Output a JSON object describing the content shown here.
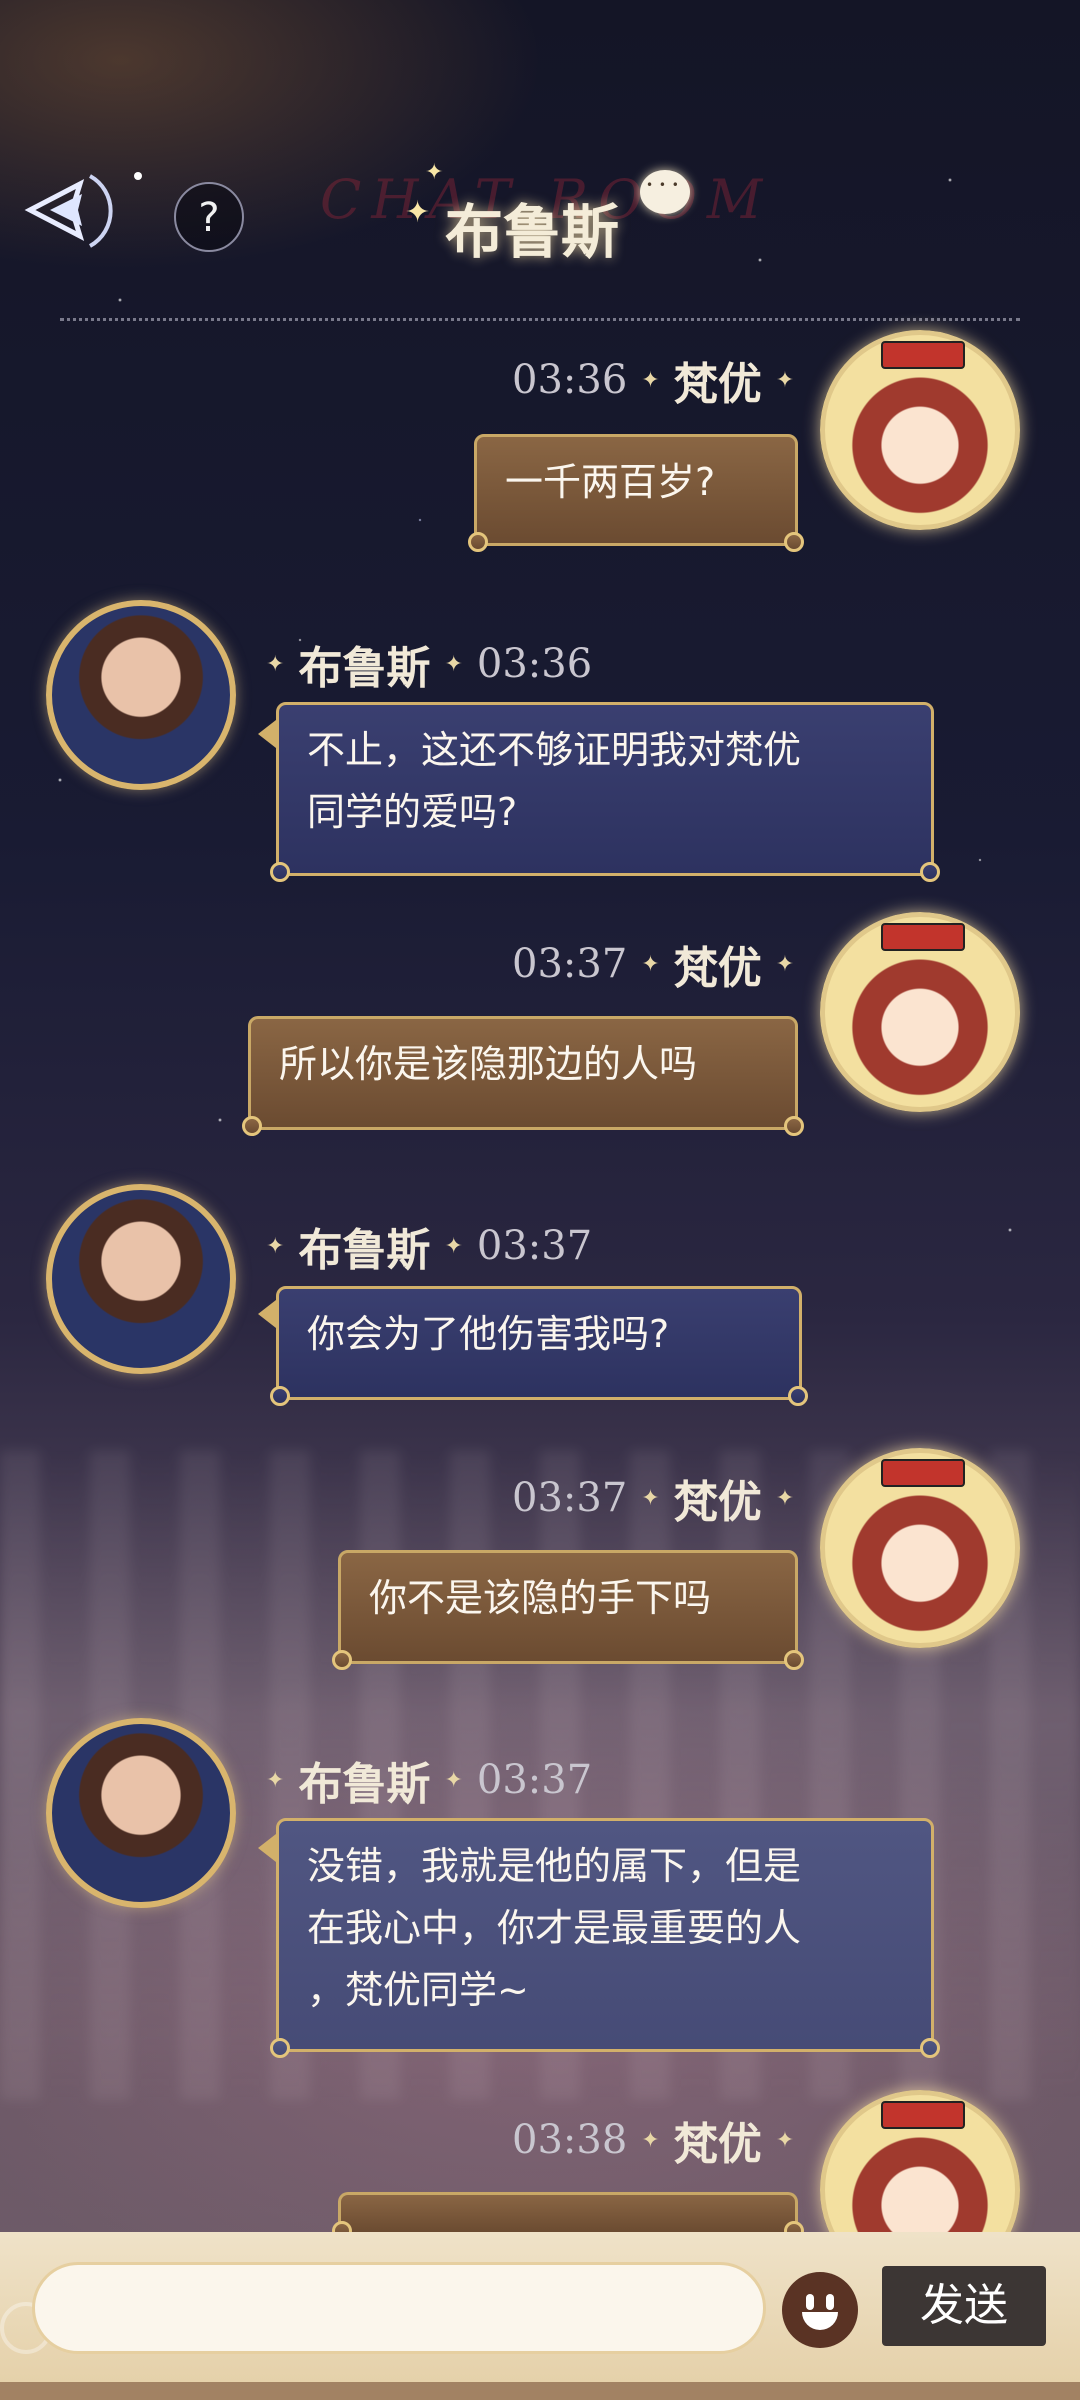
{
  "header": {
    "watermark": "CHAT ROOM",
    "title": "布鲁斯",
    "help_label": "?"
  },
  "messages": [
    {
      "sender": "梵优",
      "time": "03:36",
      "text": "一千两百岁?",
      "side": "right"
    },
    {
      "sender": "布鲁斯",
      "time": "03:36",
      "lines": [
        "不止，这还不够证明我对梵优",
        "同学的爱吗?"
      ],
      "side": "left"
    },
    {
      "sender": "梵优",
      "time": "03:37",
      "text": "所以你是该隐那边的人吗",
      "side": "right"
    },
    {
      "sender": "布鲁斯",
      "time": "03:37",
      "text": "你会为了他伤害我吗?",
      "side": "left"
    },
    {
      "sender": "梵优",
      "time": "03:37",
      "text": "你不是该隐的手下吗",
      "side": "right"
    },
    {
      "sender": "布鲁斯",
      "time": "03:37",
      "lines": [
        "没错，我就是他的属下，但是",
        "在我心中，你才是最重要的人",
        "，梵优同学~"
      ],
      "side": "left"
    },
    {
      "sender": "梵优",
      "time": "03:38",
      "text": "",
      "side": "right"
    }
  ],
  "input": {
    "placeholder": "",
    "send_label": "发送"
  },
  "colors": {
    "my_bubble": "#7a5a3c",
    "their_bubble": "#333866",
    "gold_border": "#c9a866"
  }
}
